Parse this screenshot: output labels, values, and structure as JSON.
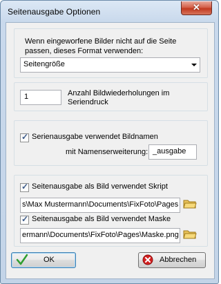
{
  "window": {
    "title": "Seitenausgabe Optionen",
    "close_glyph": "✕"
  },
  "format": {
    "line1": "Wenn eingeworfene Bilder nicht auf die Seite",
    "line2": "passen, dieses Format verwenden:",
    "selected": "Seitengröße"
  },
  "repeat": {
    "value": "1",
    "label1": "Anzahl Bildwiederholungen im",
    "label2": "Seriendruck"
  },
  "serial": {
    "checked": true,
    "label": "Serienausgabe verwendet Bildnamen",
    "ext_label": "mit Namenserweiterung:",
    "ext_value": "_ausgabe"
  },
  "script": {
    "checked": true,
    "label": "Seitenausgabe  als Bild verwendet Skript",
    "path": "s\\Max Mustermann\\Documents\\FixFoto\\Pages"
  },
  "mask": {
    "checked": true,
    "label": "Seitenausgabe  als Bild verwendet Maske",
    "path": "ermann\\Documents\\FixFoto\\Pages\\Maske.png"
  },
  "buttons": {
    "ok": "OK",
    "cancel": "Abbrechen"
  },
  "icons": {
    "check": "✓",
    "ok_icon": "green-check-icon",
    "cancel_icon": "red-x-circle-icon",
    "browse_icon": "folder-icon"
  },
  "colors": {
    "ok_check": "#2f9e2f",
    "cancel_circle": "#d32020"
  }
}
